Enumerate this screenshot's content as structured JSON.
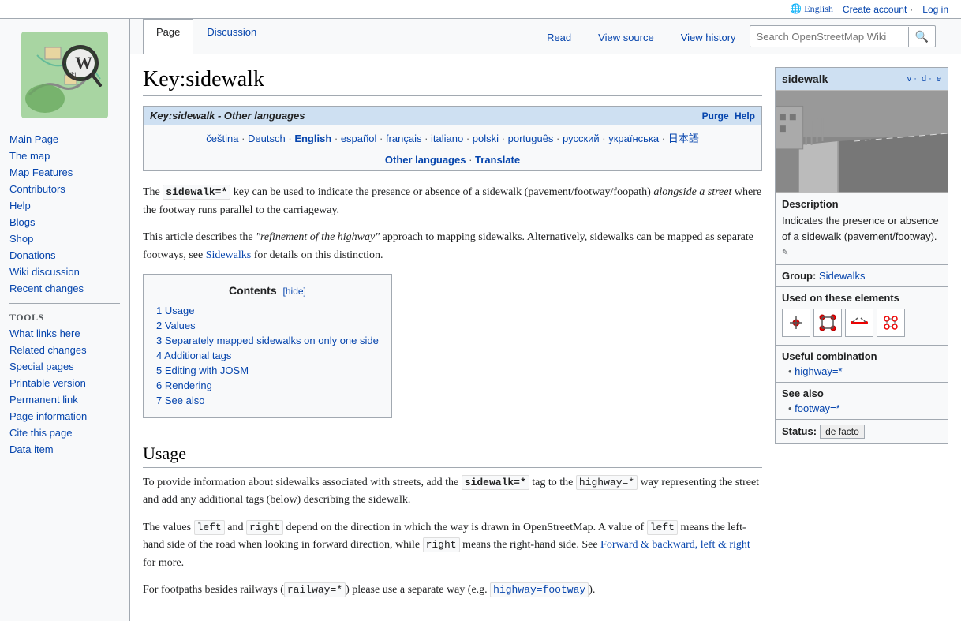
{
  "topbar": {
    "language_icon": "🌐",
    "language": "English",
    "create_account": "Create account",
    "log_in": "Log in"
  },
  "tabs": {
    "page": "Page",
    "discussion": "Discussion",
    "read": "Read",
    "view_source": "View source",
    "view_history": "View history"
  },
  "search": {
    "placeholder": "Search OpenStreetMap Wiki"
  },
  "sidebar": {
    "nav_items": [
      {
        "label": "Main Page",
        "href": "#"
      },
      {
        "label": "The map",
        "href": "#"
      },
      {
        "label": "Map Features",
        "href": "#"
      },
      {
        "label": "Contributors",
        "href": "#"
      },
      {
        "label": "Help",
        "href": "#"
      },
      {
        "label": "Blogs",
        "href": "#"
      },
      {
        "label": "Shop",
        "href": "#"
      },
      {
        "label": "Donations",
        "href": "#"
      },
      {
        "label": "Wiki discussion",
        "href": "#"
      },
      {
        "label": "Recent changes",
        "href": "#"
      }
    ],
    "tools_title": "Tools",
    "tools_items": [
      {
        "label": "What links here",
        "href": "#"
      },
      {
        "label": "Related changes",
        "href": "#"
      },
      {
        "label": "Special pages",
        "href": "#"
      },
      {
        "label": "Printable version",
        "href": "#"
      },
      {
        "label": "Permanent link",
        "href": "#"
      },
      {
        "label": "Page information",
        "href": "#"
      },
      {
        "label": "Cite this page",
        "href": "#"
      },
      {
        "label": "Data item",
        "href": "#"
      }
    ]
  },
  "page": {
    "title": "Key:sidewalk",
    "lang_box": {
      "header": "Key:sidewalk - Other languages",
      "purge": "Purge",
      "help": "Help",
      "languages": [
        {
          "label": "čeština",
          "current": false
        },
        {
          "label": "Deutsch",
          "current": false
        },
        {
          "label": "English",
          "current": true
        },
        {
          "label": "español",
          "current": false
        },
        {
          "label": "français",
          "current": false
        },
        {
          "label": "italiano",
          "current": false
        },
        {
          "label": "polski",
          "current": false
        },
        {
          "label": "português",
          "current": false
        },
        {
          "label": "русский",
          "current": false
        },
        {
          "label": "українська",
          "current": false
        },
        {
          "label": "日本語",
          "current": false
        }
      ],
      "other_languages": "Other languages",
      "translate": "Translate"
    },
    "intro_para1": "The sidewalk=* key can be used to indicate the presence or absence of a sidewalk (pavement/footway/foopath) alongside a street where the footway runs parallel to the carriageway.",
    "intro_para2": "This article describes the \"refinement of the highway\" approach to mapping sidewalks. Alternatively, sidewalks can be mapped as separate footways, see Sidewalks for details on this distinction.",
    "toc": {
      "title": "Contents",
      "hide_label": "[hide]",
      "items": [
        {
          "num": "1",
          "label": "Usage"
        },
        {
          "num": "2",
          "label": "Values"
        },
        {
          "num": "3",
          "label": "Separately mapped sidewalks on only one side"
        },
        {
          "num": "4",
          "label": "Additional tags"
        },
        {
          "num": "5",
          "label": "Editing with JOSM"
        },
        {
          "num": "6",
          "label": "Rendering"
        },
        {
          "num": "7",
          "label": "See also"
        }
      ]
    },
    "usage_heading": "Usage",
    "usage_para1_before": "To provide information about sidewalks associated with streets, add the ",
    "usage_para1_tag": "sidewalk=*",
    "usage_para1_after": " tag to the ",
    "usage_para1_tag2": "highway=*",
    "usage_para1_end": " way representing the street and add any additional tags (below) describing the sidewalk.",
    "usage_para2_before": "The values ",
    "usage_para2_left": "left",
    "usage_para2_mid": " and ",
    "usage_para2_right": "right",
    "usage_para2_after": " depend on the direction in which the way is drawn in OpenStreetMap. A value of ",
    "usage_para2_left2": "left",
    "usage_para2_after2": " means the left-hand side of the road when looking in forward direction, while ",
    "usage_para2_right2": "right",
    "usage_para2_after3": " means the right-hand side. See Forward & backward, left & right for more.",
    "usage_para3_before": "For footpaths besides railways (",
    "usage_para3_tag": "railway=*",
    "usage_para3_mid": ") please use a separate way (e.g. ",
    "usage_para3_tag2": "highway=footway",
    "usage_para3_end": ")."
  },
  "infobox": {
    "tag_name": "sidewalk",
    "vde": "v · d · e",
    "description_title": "Description",
    "description_text": "Indicates the presence or absence of a sidewalk (pavement/footway).",
    "group_title": "Group:",
    "group_name": "Sidewalks",
    "elements_title": "Used on these elements",
    "element_icons": [
      "⬡",
      "⬡",
      "⬡",
      "⬡"
    ],
    "combo_title": "Useful combination",
    "combo_items": [
      "highway=*"
    ],
    "see_also_title": "See also",
    "see_also_items": [
      "footway=*"
    ],
    "status_label": "Status:",
    "status_value": "de facto"
  }
}
